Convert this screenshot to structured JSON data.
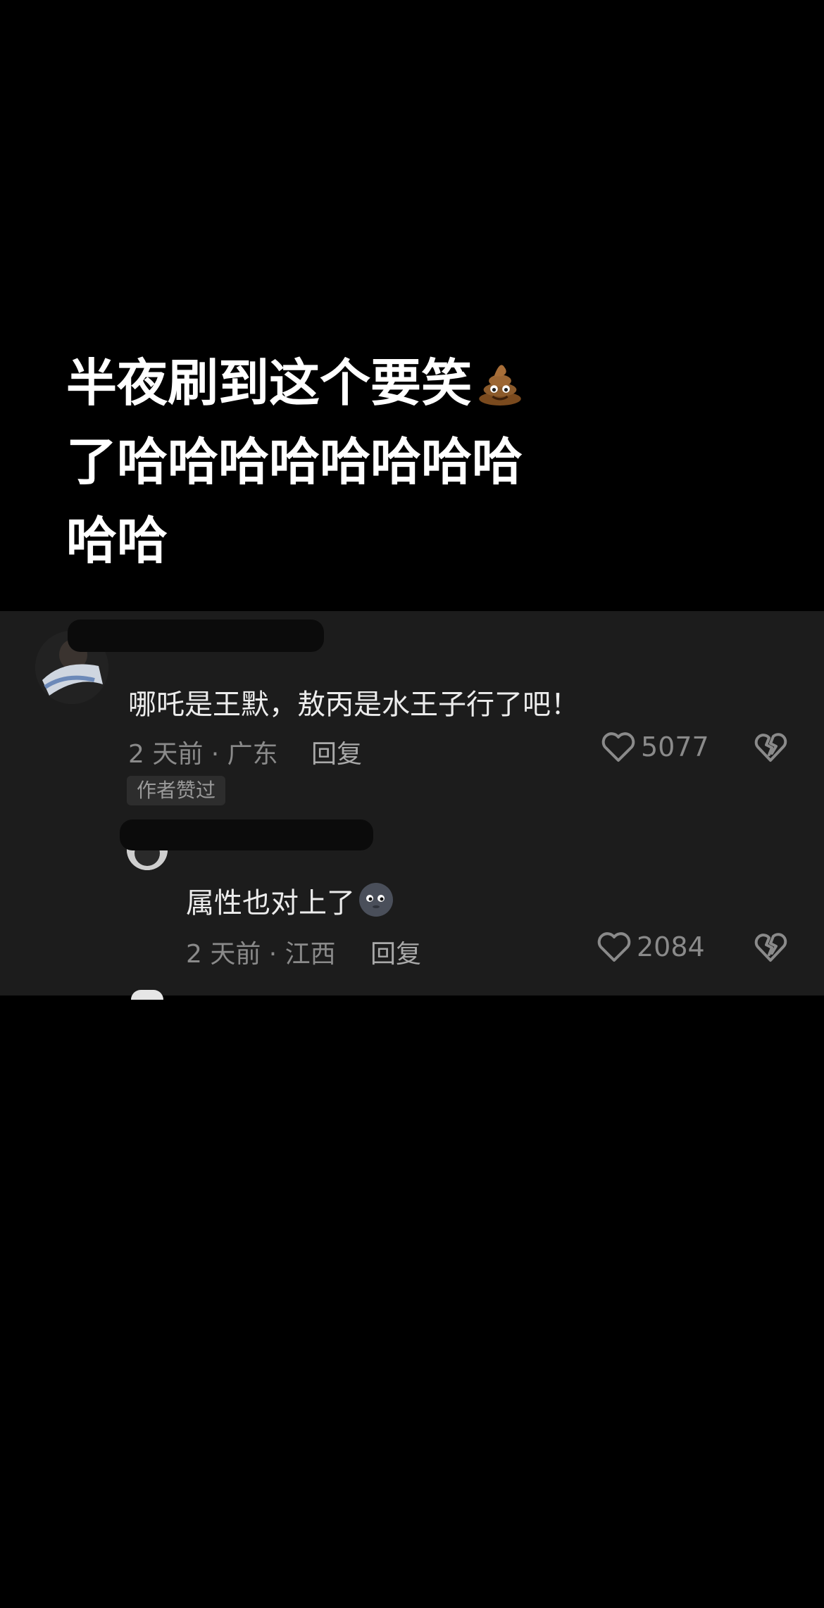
{
  "caption": {
    "line1": "半夜刷到这个要笑",
    "line2": "了哈哈哈哈哈哈哈哈",
    "line3": "哈哈",
    "emoji": "poop-emoji"
  },
  "comments": [
    {
      "text": "哪吒是王默，敖丙是水王子行了吧！",
      "time_location": "2 天前 · 广东",
      "reply_label": "回复",
      "likes": "5077",
      "badge": "作者赞过"
    },
    {
      "text": "属性也对上了",
      "emoji": "moon-face-emoji",
      "time_location": "2 天前 · 江西",
      "reply_label": "回复",
      "likes": "2084"
    }
  ],
  "colors": {
    "background": "#000000",
    "panel": "#1c1c1c",
    "text_primary": "#ececec",
    "text_secondary": "#8a8a8a"
  }
}
